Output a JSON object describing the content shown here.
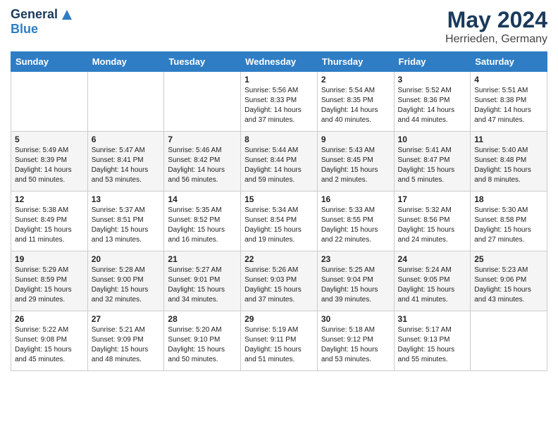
{
  "header": {
    "logo_general": "General",
    "logo_blue": "Blue",
    "month_title": "May 2024",
    "location": "Herrieden, Germany"
  },
  "calendar": {
    "days_of_week": [
      "Sunday",
      "Monday",
      "Tuesday",
      "Wednesday",
      "Thursday",
      "Friday",
      "Saturday"
    ],
    "weeks": [
      [
        {
          "day": "",
          "info": ""
        },
        {
          "day": "",
          "info": ""
        },
        {
          "day": "",
          "info": ""
        },
        {
          "day": "1",
          "info": "Sunrise: 5:56 AM\nSunset: 8:33 PM\nDaylight: 14 hours\nand 37 minutes."
        },
        {
          "day": "2",
          "info": "Sunrise: 5:54 AM\nSunset: 8:35 PM\nDaylight: 14 hours\nand 40 minutes."
        },
        {
          "day": "3",
          "info": "Sunrise: 5:52 AM\nSunset: 8:36 PM\nDaylight: 14 hours\nand 44 minutes."
        },
        {
          "day": "4",
          "info": "Sunrise: 5:51 AM\nSunset: 8:38 PM\nDaylight: 14 hours\nand 47 minutes."
        }
      ],
      [
        {
          "day": "5",
          "info": "Sunrise: 5:49 AM\nSunset: 8:39 PM\nDaylight: 14 hours\nand 50 minutes."
        },
        {
          "day": "6",
          "info": "Sunrise: 5:47 AM\nSunset: 8:41 PM\nDaylight: 14 hours\nand 53 minutes."
        },
        {
          "day": "7",
          "info": "Sunrise: 5:46 AM\nSunset: 8:42 PM\nDaylight: 14 hours\nand 56 minutes."
        },
        {
          "day": "8",
          "info": "Sunrise: 5:44 AM\nSunset: 8:44 PM\nDaylight: 14 hours\nand 59 minutes."
        },
        {
          "day": "9",
          "info": "Sunrise: 5:43 AM\nSunset: 8:45 PM\nDaylight: 15 hours\nand 2 minutes."
        },
        {
          "day": "10",
          "info": "Sunrise: 5:41 AM\nSunset: 8:47 PM\nDaylight: 15 hours\nand 5 minutes."
        },
        {
          "day": "11",
          "info": "Sunrise: 5:40 AM\nSunset: 8:48 PM\nDaylight: 15 hours\nand 8 minutes."
        }
      ],
      [
        {
          "day": "12",
          "info": "Sunrise: 5:38 AM\nSunset: 8:49 PM\nDaylight: 15 hours\nand 11 minutes."
        },
        {
          "day": "13",
          "info": "Sunrise: 5:37 AM\nSunset: 8:51 PM\nDaylight: 15 hours\nand 13 minutes."
        },
        {
          "day": "14",
          "info": "Sunrise: 5:35 AM\nSunset: 8:52 PM\nDaylight: 15 hours\nand 16 minutes."
        },
        {
          "day": "15",
          "info": "Sunrise: 5:34 AM\nSunset: 8:54 PM\nDaylight: 15 hours\nand 19 minutes."
        },
        {
          "day": "16",
          "info": "Sunrise: 5:33 AM\nSunset: 8:55 PM\nDaylight: 15 hours\nand 22 minutes."
        },
        {
          "day": "17",
          "info": "Sunrise: 5:32 AM\nSunset: 8:56 PM\nDaylight: 15 hours\nand 24 minutes."
        },
        {
          "day": "18",
          "info": "Sunrise: 5:30 AM\nSunset: 8:58 PM\nDaylight: 15 hours\nand 27 minutes."
        }
      ],
      [
        {
          "day": "19",
          "info": "Sunrise: 5:29 AM\nSunset: 8:59 PM\nDaylight: 15 hours\nand 29 minutes."
        },
        {
          "day": "20",
          "info": "Sunrise: 5:28 AM\nSunset: 9:00 PM\nDaylight: 15 hours\nand 32 minutes."
        },
        {
          "day": "21",
          "info": "Sunrise: 5:27 AM\nSunset: 9:01 PM\nDaylight: 15 hours\nand 34 minutes."
        },
        {
          "day": "22",
          "info": "Sunrise: 5:26 AM\nSunset: 9:03 PM\nDaylight: 15 hours\nand 37 minutes."
        },
        {
          "day": "23",
          "info": "Sunrise: 5:25 AM\nSunset: 9:04 PM\nDaylight: 15 hours\nand 39 minutes."
        },
        {
          "day": "24",
          "info": "Sunrise: 5:24 AM\nSunset: 9:05 PM\nDaylight: 15 hours\nand 41 minutes."
        },
        {
          "day": "25",
          "info": "Sunrise: 5:23 AM\nSunset: 9:06 PM\nDaylight: 15 hours\nand 43 minutes."
        }
      ],
      [
        {
          "day": "26",
          "info": "Sunrise: 5:22 AM\nSunset: 9:08 PM\nDaylight: 15 hours\nand 45 minutes."
        },
        {
          "day": "27",
          "info": "Sunrise: 5:21 AM\nSunset: 9:09 PM\nDaylight: 15 hours\nand 48 minutes."
        },
        {
          "day": "28",
          "info": "Sunrise: 5:20 AM\nSunset: 9:10 PM\nDaylight: 15 hours\nand 50 minutes."
        },
        {
          "day": "29",
          "info": "Sunrise: 5:19 AM\nSunset: 9:11 PM\nDaylight: 15 hours\nand 51 minutes."
        },
        {
          "day": "30",
          "info": "Sunrise: 5:18 AM\nSunset: 9:12 PM\nDaylight: 15 hours\nand 53 minutes."
        },
        {
          "day": "31",
          "info": "Sunrise: 5:17 AM\nSunset: 9:13 PM\nDaylight: 15 hours\nand 55 minutes."
        },
        {
          "day": "",
          "info": ""
        }
      ]
    ]
  }
}
